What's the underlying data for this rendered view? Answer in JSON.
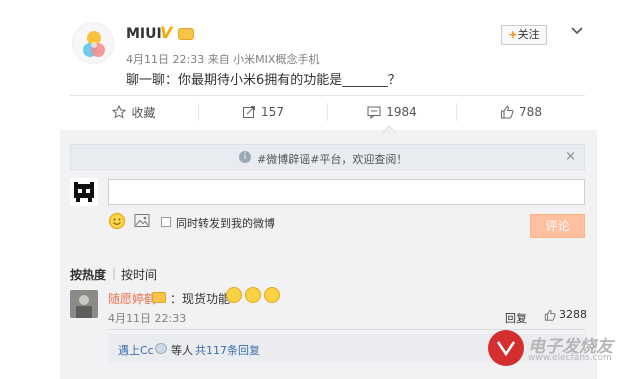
{
  "post": {
    "author": "MIUI",
    "verified_mark": "V",
    "meta": "4月11日 22:33 来自 小米MIX概念手机",
    "text": "聊一聊：你最期待小米6拥有的功能是_______？",
    "follow_label": "关注",
    "follow_plus": "+"
  },
  "actions": {
    "favorite": "收藏",
    "repost": "157",
    "comment": "1984",
    "like": "788"
  },
  "notice": {
    "text": "#微博辟谣#平台，欢迎查阅！",
    "info_glyph": "i",
    "close_glyph": "×"
  },
  "composer": {
    "repost_label": "同时转发到我的微博",
    "submit_label": "评论"
  },
  "sort": {
    "hot": "按热度",
    "separator": "|",
    "time": "按时间"
  },
  "comment": {
    "author": "随愿婷鹤",
    "text": "：现货功能",
    "time": "4月11日 22:33",
    "reply_label": "回复",
    "likes": "3288"
  },
  "sub_replies": {
    "user": "遇上Cc",
    "others": "等人",
    "total": "共117条回复"
  },
  "watermark": {
    "text": "电子发烧友",
    "url": "www.elecfans.com"
  },
  "colors": {
    "accent_orange": "#ff8200",
    "link_blue": "#3a6fae",
    "author_orange": "#eb7350",
    "submit_disabled": "#ffc09f"
  }
}
